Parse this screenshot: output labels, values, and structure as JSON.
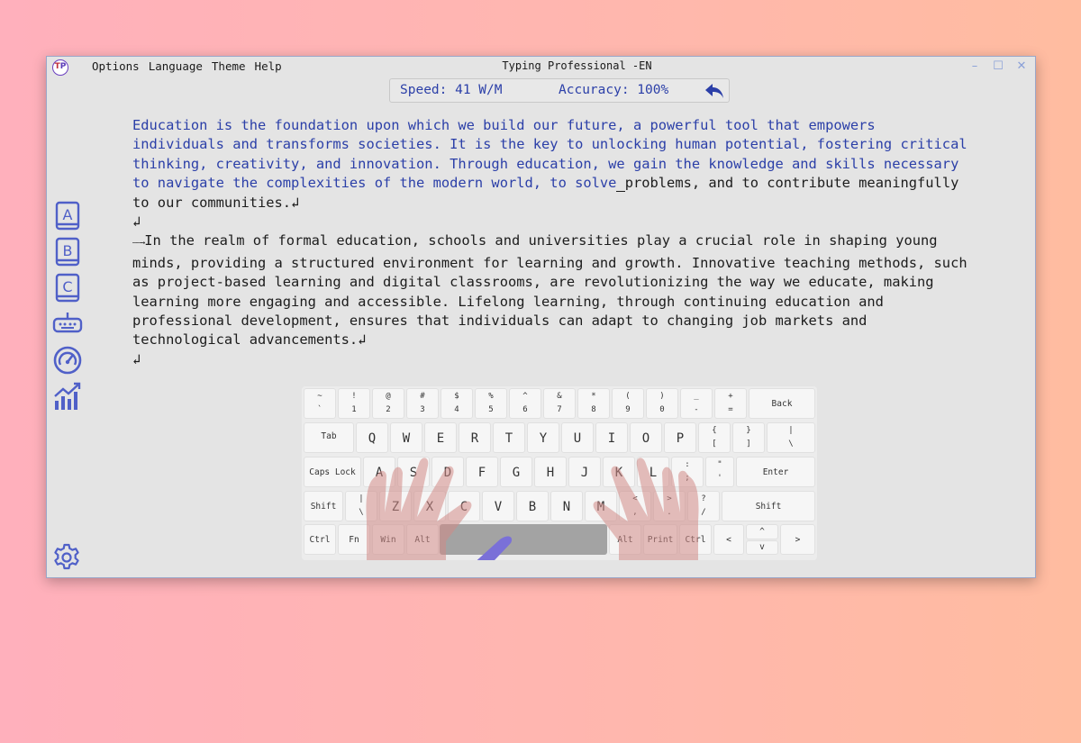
{
  "app": {
    "title": "Typing Professional -EN",
    "logo_text_a": "T",
    "logo_text_b": "P"
  },
  "menu": {
    "items": [
      "Options",
      "Language",
      "Theme",
      "Help"
    ]
  },
  "window_controls": {
    "minimize": "–",
    "maximize": "☐",
    "close": "✕"
  },
  "status": {
    "speed": "Speed: 41 W/M",
    "accuracy": "Accuracy: 100%"
  },
  "sidebar": {
    "items": [
      "lesson-a-icon",
      "lesson-b-icon",
      "lesson-c-icon",
      "keyboard-icon",
      "speedometer-icon",
      "statistics-chart-icon"
    ],
    "settings": "gear-icon"
  },
  "colors": {
    "accent": "#2b3fa8",
    "icon": "#5060c8",
    "hand": "#d28a86",
    "finger_highlight": "#7a70d8"
  },
  "text": {
    "typed": "Education is the foundation upon which we build our future, a powerful tool that empowers\nindividuals and transforms societies. It is the key to unlocking human potential, fostering critical\nthinking, creativity, and innovation. Through education, we gain the knowledge and skills necessary\nto navigate the complexities of the modern world, to solve",
    "cursor": " ",
    "remaining_p1": "problems, and to contribute meaningfully\nto our communities.↲\n↲\n",
    "tab_arrow": "——→",
    "remaining_p2": "In the realm of formal education, schools and universities play a crucial role in shaping young\nminds, providing a structured environment for learning and growth. Innovative teaching methods, such\nas project-based learning and digital classrooms, are revolutionizing the way we educate, making\nlearning more engaging and accessible. Lifelong learning, through continuing education and\nprofessional development, ensures that individuals can adapt to changing job markets and\ntechnological advancements.↲\n↲"
  },
  "keyboard": {
    "row1": [
      [
        "~",
        "`"
      ],
      [
        "!",
        "1"
      ],
      [
        "@",
        "2"
      ],
      [
        "#",
        "3"
      ],
      [
        "$",
        "4"
      ],
      [
        "%",
        "5"
      ],
      [
        "^",
        "6"
      ],
      [
        "&",
        "7"
      ],
      [
        "*",
        "8"
      ],
      [
        "(",
        "9"
      ],
      [
        ")",
        "0"
      ],
      [
        "_",
        "-"
      ],
      [
        "+",
        "="
      ]
    ],
    "back": "Back",
    "tab": "Tab",
    "row2": [
      "Q",
      "W",
      "E",
      "R",
      "T",
      "Y",
      "U",
      "I",
      "O",
      "P"
    ],
    "row2_sym": [
      [
        "{",
        "["
      ],
      [
        "}",
        "]"
      ],
      [
        "|",
        "\\"
      ]
    ],
    "caps": "Caps Lock",
    "row3": [
      "A",
      "S",
      "D",
      "F",
      "G",
      "H",
      "J",
      "K",
      "L"
    ],
    "row3_sym": [
      [
        ":",
        ";"
      ],
      [
        "\"",
        "'"
      ]
    ],
    "enter": "Enter",
    "shift_left": "Shift",
    "row4_first": [
      "|",
      "\\"
    ],
    "row4": [
      "Z",
      "X",
      "C",
      "V",
      "B",
      "N",
      "M"
    ],
    "row4_sym": [
      [
        "<",
        ","
      ],
      [
        ">",
        "."
      ],
      [
        "?",
        "/"
      ]
    ],
    "shift_right": "Shift",
    "row5_left": [
      "Ctrl",
      "Fn",
      "Win",
      "Alt"
    ],
    "row5_right": [
      "Alt",
      "Print",
      "Ctrl"
    ],
    "arrow_left": "<",
    "arrow_up": "^",
    "arrow_down": "v",
    "arrow_right": ">"
  }
}
